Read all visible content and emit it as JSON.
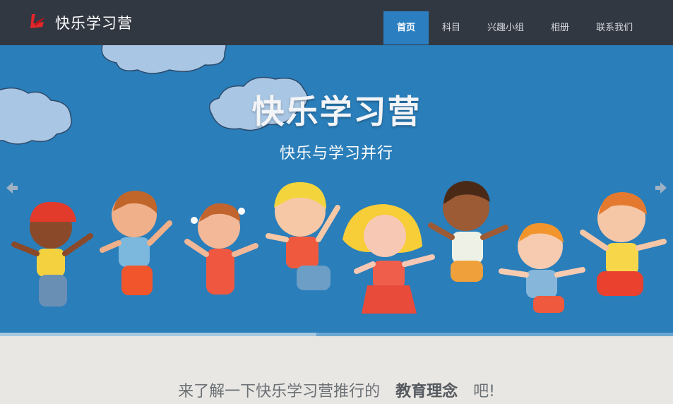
{
  "brand": {
    "name": "快乐学习营",
    "logo_icon": "red-swoosh-logo-icon",
    "accent": "#e3262b"
  },
  "nav": {
    "items": [
      {
        "label": "首页",
        "active": true
      },
      {
        "label": "科目",
        "active": false
      },
      {
        "label": "兴趣小组",
        "active": false
      },
      {
        "label": "相册",
        "active": false
      },
      {
        "label": "联系我们",
        "active": false
      }
    ],
    "active_color": "#2b7fc0"
  },
  "hero": {
    "title": "快乐学习营",
    "subtitle": "快乐与学习并行",
    "prev_icon": "arrow-left-icon",
    "next_icon": "arrow-right-icon",
    "background": "#2a7eba",
    "slide_progress": 0.47
  },
  "intro": {
    "prefix": "来了解一下快乐学习营推行的",
    "keyword": "教育理念",
    "suffix": "吧!"
  }
}
